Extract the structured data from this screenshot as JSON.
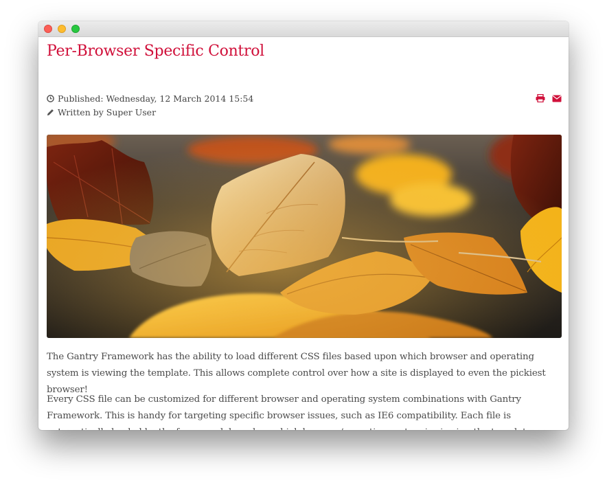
{
  "window": {
    "controls": [
      "close",
      "minimize",
      "maximize"
    ]
  },
  "article": {
    "title": "Per-Browser Specific Control",
    "published": "Published: Wednesday, 12 March 2014 15:54",
    "author": "Written by Super User",
    "actions": {
      "print_icon": "print-icon",
      "email_icon": "email-icon"
    },
    "image": {
      "subject": "autumn-leaves-photo"
    },
    "paragraphs": [
      "The Gantry Framework has the ability to load different CSS files based upon which browser and operating system is viewing the template. This allows complete control over how a site is displayed to even the pickiest browser!",
      "Every CSS file can be customized for different browser and operating system combinations with Gantry Framework. This is handy for targeting specific browser issues, such as IE6 compatibility. Each file is automatically loaded by the framework based on which browser/operating system is viewing the template."
    ]
  },
  "colors": {
    "accent": "#d0103a",
    "text": "#4a4a4a",
    "meta": "#444444"
  }
}
